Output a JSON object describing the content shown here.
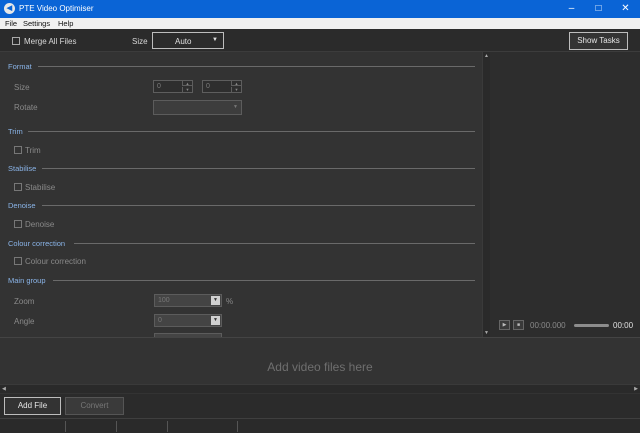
{
  "window": {
    "title": "PTE Video Optimiser"
  },
  "menu": [
    "File",
    "Settings",
    "Help"
  ],
  "toolbar": {
    "merge_label": "Merge All Files",
    "size_label": "Size",
    "size_value": "Auto",
    "show_tasks": "Show Tasks"
  },
  "settings": {
    "format": {
      "title": "Format",
      "size_label": "Size",
      "width": "0",
      "height": "0",
      "rotate_label": "Rotate"
    },
    "trim": {
      "title": "Trim",
      "check_label": "Trim"
    },
    "stabilise": {
      "title": "Stabilise",
      "check_label": "Stabilise"
    },
    "denoise": {
      "title": "Denoise",
      "check_label": "Denoise"
    },
    "colour": {
      "title": "Colour correction",
      "check_label": "Colour correction"
    },
    "main": {
      "title": "Main group",
      "zoom_label": "Zoom",
      "zoom_value": "100",
      "zoom_unit": "%",
      "angle_label": "Angle",
      "angle_value": "0"
    }
  },
  "player": {
    "time_current": "00:00.000",
    "time_total": "00:00"
  },
  "dropzone": {
    "hint": "Add video files here"
  },
  "buttons": {
    "add_file": "Add File",
    "convert": "Convert"
  },
  "colors": {
    "titlebar": "#0a64d6",
    "section_header": "#8ab4e8"
  }
}
